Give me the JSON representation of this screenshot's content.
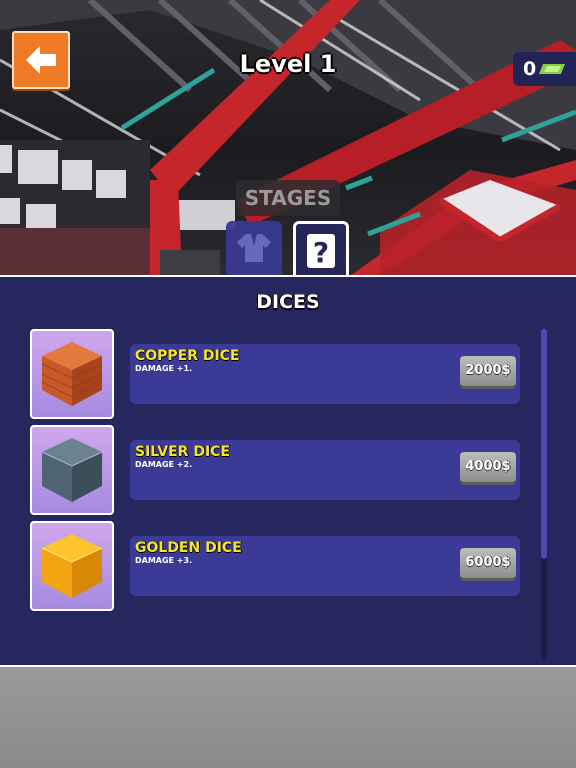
{
  "header": {
    "level_title": "Level 1",
    "cash_amount": "0",
    "back_icon": "arrow-left-icon",
    "cash_icon": "banknote-icon"
  },
  "tabs": {
    "stages_label": "STAGES",
    "skins_icon": "shirt-icon",
    "dices_icon": "question-mark-icon",
    "active": "dices"
  },
  "shop": {
    "title": "DICES",
    "items": [
      {
        "name": "COPPER DICE",
        "desc": "DAMAGE +1.",
        "price": "2000$",
        "color": "#c85d2a"
      },
      {
        "name": "SILVER DICE",
        "desc": "DAMAGE +2.",
        "price": "4000$",
        "color": "#4f6473"
      },
      {
        "name": "GOLDEN DICE",
        "desc": "DAMAGE +3.",
        "price": "6000$",
        "color": "#f2a511"
      }
    ]
  },
  "colors": {
    "panel_bg": "#272760",
    "card_bg": "#3b3b97",
    "accent_orange": "#f07b26",
    "item_name": "#f4e52b"
  }
}
